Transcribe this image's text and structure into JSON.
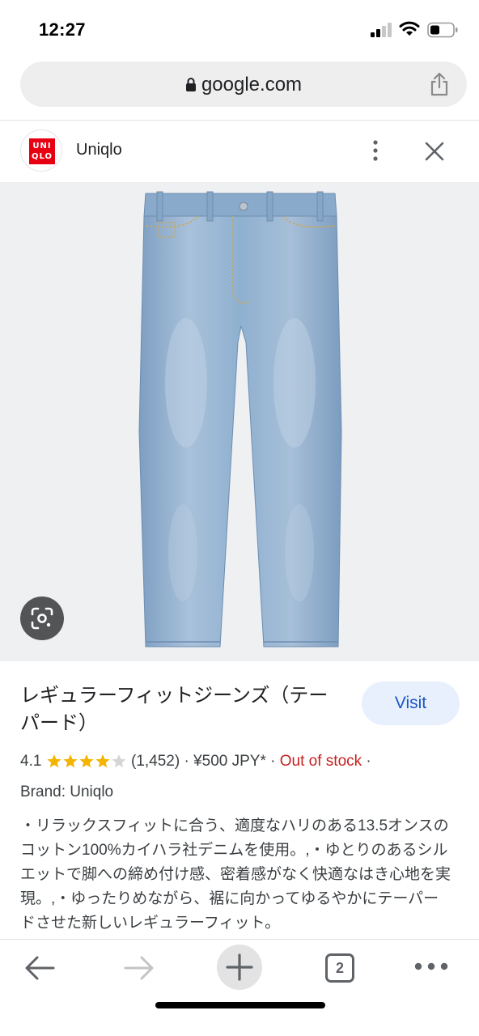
{
  "status_bar": {
    "time": "12:27"
  },
  "browser": {
    "url": "google.com"
  },
  "source": {
    "logo_text": "UNI QLO",
    "name": "Uniqlo"
  },
  "product": {
    "title": "レギュラーフィットジーンズ（テーパード）",
    "visit_label": "Visit",
    "rating": "4.1",
    "rating_stars": 4.1,
    "review_count": "(1,452)",
    "price": "¥500 JPY*",
    "availability": "Out of stock",
    "brand": "Brand: Uniqlo",
    "description": "・リラックスフィットに合う、適度なハリのある13.5オンスのコットン100%カイハラ社デニムを使用。,・ゆとりのあるシルエットで脚への締め付け感、密着感がなく快適なはき心地を実現。,・ゆったりめながら、裾に向かってゆるやかにテーパードさせた新しいレギュラーフィット。"
  },
  "toolbar": {
    "tab_count": "2"
  },
  "colors": {
    "accent_blue": "#1a56c4",
    "visit_bg": "#e8f0fe",
    "out_of_stock_red": "#c5221f",
    "star_yellow": "#f4b400",
    "brand_red": "#e60012",
    "denim": "#8fb0d0"
  },
  "icons": [
    "signal-icon",
    "wifi-icon",
    "battery-icon",
    "lock-icon",
    "share-icon",
    "more-vert-icon",
    "close-icon",
    "lens-icon",
    "back-arrow-icon",
    "forward-arrow-icon",
    "plus-icon",
    "tabs-icon",
    "more-horiz-icon"
  ]
}
